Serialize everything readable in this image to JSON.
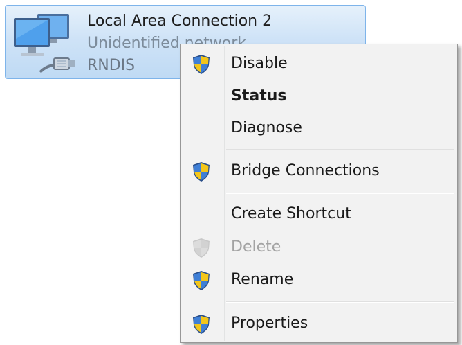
{
  "connection": {
    "name": "Local Area Connection 2",
    "status": "Unidentified network",
    "device": "RNDIS"
  },
  "context_menu": {
    "items": [
      {
        "label": "Disable",
        "shield": true,
        "bold": false,
        "disabled": false
      },
      {
        "label": "Status",
        "shield": false,
        "bold": true,
        "disabled": false
      },
      {
        "label": "Diagnose",
        "shield": false,
        "bold": false,
        "disabled": false
      },
      {
        "label": "Bridge Connections",
        "shield": true,
        "bold": false,
        "disabled": false
      },
      {
        "label": "Create Shortcut",
        "shield": false,
        "bold": false,
        "disabled": false
      },
      {
        "label": "Delete",
        "shield": true,
        "bold": false,
        "disabled": true
      },
      {
        "label": "Rename",
        "shield": true,
        "bold": false,
        "disabled": false
      },
      {
        "label": "Properties",
        "shield": true,
        "bold": false,
        "disabled": false
      }
    ]
  },
  "icons": {
    "connection": "network-adapter-icon",
    "uac": "uac-shield-icon"
  }
}
